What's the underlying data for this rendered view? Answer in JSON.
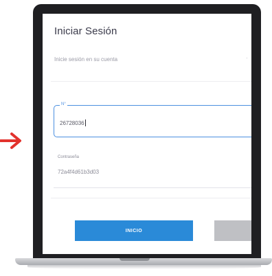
{
  "login": {
    "title": "Iniciar Sesión",
    "subtitle": "Inicie sesión en su cuenta",
    "user_label": "N°",
    "user_value": "26728036",
    "password_label": "Contraseña",
    "password_value": "72a4f4d61b3d03",
    "submit_label": "INICIO"
  },
  "colors": {
    "accent": "#2a8ad8",
    "focus_border": "#4a8fe0",
    "arrow": "#e2322d",
    "secondary_button": "#bfc0c4",
    "bezel": "#1f1f22"
  },
  "icons": {
    "arrow": "arrow-right-icon"
  }
}
